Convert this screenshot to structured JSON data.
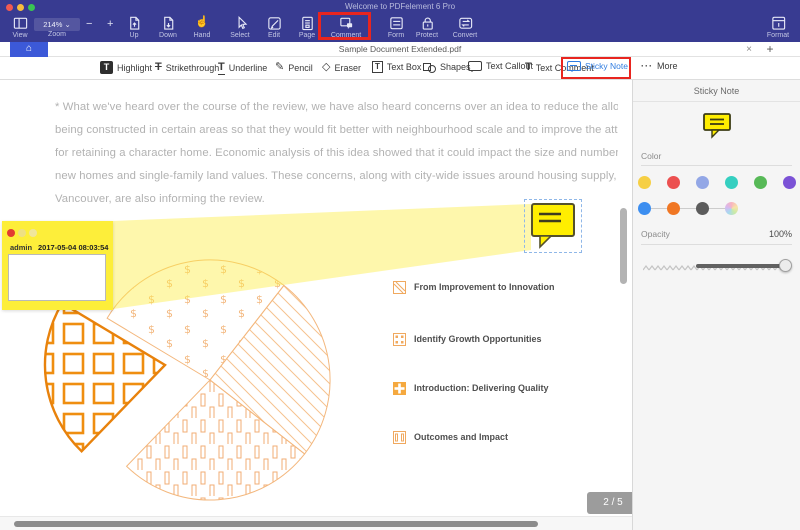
{
  "window": {
    "title": "Welcome to PDFelement 6 Pro",
    "page_indicator": "2 / 5"
  },
  "toolbar": {
    "zoom_value": "214%",
    "zoom_chevron": "⌄",
    "zoom_label": "Zoom",
    "minus": "−",
    "plus": "+",
    "buttons": [
      {
        "label": "View"
      },
      {
        "label": "Up"
      },
      {
        "label": "Down"
      },
      {
        "label": "Hand"
      },
      {
        "label": "Select"
      },
      {
        "label": "Edit"
      },
      {
        "label": "Page"
      },
      {
        "label": "Comment",
        "highlighted": true
      },
      {
        "label": "Form"
      },
      {
        "label": "Protect"
      },
      {
        "label": "Convert"
      },
      {
        "label": "Format"
      }
    ],
    "hand_glyph": "☝"
  },
  "tabbar": {
    "home_glyph": "⌂",
    "document_title": "Sample Document Extended.pdf",
    "close": "×",
    "add": "+"
  },
  "tools": [
    {
      "label": "Highlight",
      "glyph": "T"
    },
    {
      "label": "Strikethrough",
      "glyph": "T"
    },
    {
      "label": "Underline",
      "glyph": "T"
    },
    {
      "label": "Pencil",
      "glyph": "✎"
    },
    {
      "label": "Eraser",
      "glyph": "◇"
    },
    {
      "label": "Text Box",
      "glyph": "T"
    },
    {
      "label": "Shapes"
    },
    {
      "label": "Text Callout"
    },
    {
      "label": "Text Comment",
      "glyph": "T"
    },
    {
      "label": "Sticky Note",
      "active": true
    },
    {
      "label": "More",
      "glyph": "···"
    }
  ],
  "document": {
    "paragraph_lines": [
      "* What we've heard over the course of the review, we have also heard concerns over an idea to reduce the allowable size of new homes",
      "being constructed in certain areas so that they would fit better with neighbourhood scale and to improve the attractiveness of the incentiv",
      "for retaining a character home. Economic analysis of this idea showed that it could impact the size and number of secondary suites in",
      "new homes and single-family land values. These concerns, along with city-wide issues around housing supply, options, and affordability i",
      "Vancouver, are also informing the review."
    ],
    "note_popup": {
      "user": "admin",
      "timestamp": "2017-05-04 08:03:54"
    },
    "legend": [
      "From Improvement to Innovation",
      "Identify Growth Opportunities",
      "Introduction: Delivering Quality",
      "Outcomes and Impact"
    ]
  },
  "chart_data": {
    "type": "pie",
    "labels": [
      "From Improvement to Innovation",
      "Identify Growth Opportunities",
      "Introduction: Delivering Quality",
      "Outcomes and Impact"
    ],
    "values_pct_estimated": [
      25,
      27,
      21,
      27
    ],
    "legend_position": "right",
    "style": "orange outline patterns (diagonal lines, dollar symbols, grid squares, dashes), one exploded slice"
  },
  "panel": {
    "title": "Sticky Note",
    "color_label": "Color",
    "opacity_label": "Opacity",
    "opacity_value": "100%",
    "swatch_colors_row1": [
      "#f6cf44",
      "#ec5050",
      "#93a7e6",
      "#35cfc0",
      "#57b957",
      "#7b52d6"
    ],
    "swatch_colors_row2": [
      "#3c8ef0",
      "#f07724",
      "#5c5c5c"
    ],
    "swatch_multicolor": "color-wheel"
  },
  "colors": {
    "toolbar_bg": "#383b91",
    "home_tab_blue": "#3c59d8",
    "highlight_red": "#e8251f",
    "popup_yellow": "#fdee3a",
    "sticky_note_yellow": "#ffee00",
    "active_tool_blue": "#2f7ce0",
    "pie_orange": "#ef8e10"
  }
}
